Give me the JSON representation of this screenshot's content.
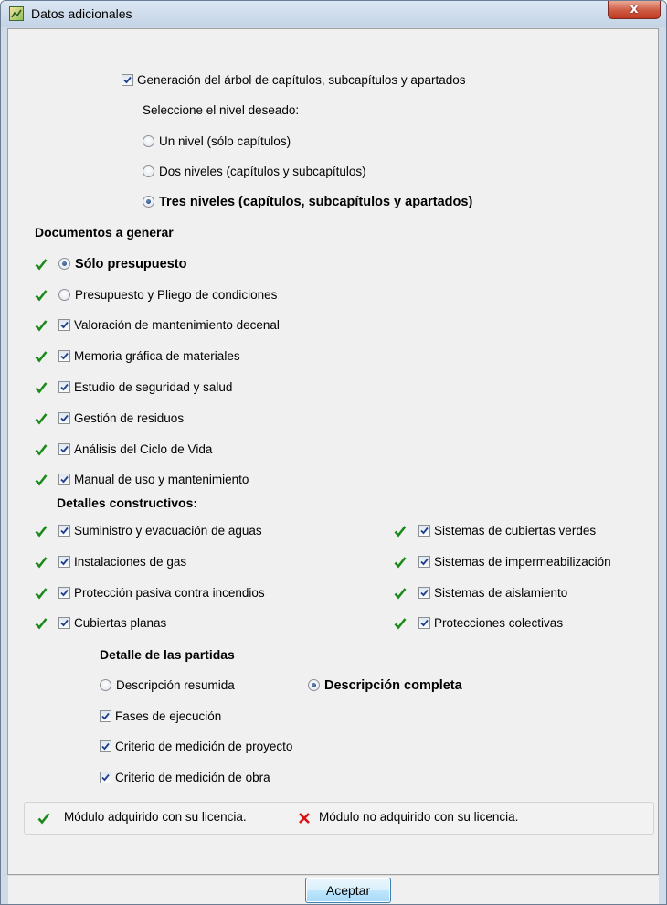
{
  "window": {
    "title": "Datos adicionales",
    "close_label": "x"
  },
  "tree": {
    "generate_label": "Generación del árbol de capítulos, subcapítulos y apartados",
    "generate_checked": true,
    "prompt": "Seleccione el nivel deseado:",
    "levels": [
      {
        "label": "Un nivel (sólo capítulos)",
        "selected": false
      },
      {
        "label": "Dos niveles (capítulos y subcapítulos)",
        "selected": false
      },
      {
        "label": "Tres niveles (capítulos, subcapítulos y apartados)",
        "selected": true
      }
    ]
  },
  "documents": {
    "heading": "Documentos a generar",
    "radio_options": [
      {
        "label": "Sólo presupuesto",
        "selected": true
      },
      {
        "label": "Presupuesto y Pliego de condiciones",
        "selected": false
      }
    ],
    "checkbox_items": [
      {
        "label": "Valoración de mantenimiento decenal",
        "checked": true
      },
      {
        "label": "Memoria gráfica de materiales",
        "checked": true
      },
      {
        "label": "Estudio de seguridad y salud",
        "checked": true
      },
      {
        "label": "Gestión de residuos",
        "checked": true
      },
      {
        "label": "Análisis del Ciclo de Vida",
        "checked": true
      },
      {
        "label": "Manual de uso y mantenimiento",
        "checked": true
      }
    ]
  },
  "details": {
    "heading": "Detalles constructivos:",
    "left": [
      {
        "label": "Suministro y evacuación de aguas",
        "checked": true
      },
      {
        "label": "Instalaciones de gas",
        "checked": true
      },
      {
        "label": "Protección pasiva contra incendios",
        "checked": true
      },
      {
        "label": "Cubiertas planas",
        "checked": true
      }
    ],
    "right": [
      {
        "label": "Sistemas de cubiertas verdes",
        "checked": true
      },
      {
        "label": "Sistemas de impermeabilización",
        "checked": true
      },
      {
        "label": "Sistemas de aislamiento",
        "checked": true
      },
      {
        "label": "Protecciones colectivas",
        "checked": true
      }
    ]
  },
  "partidas": {
    "heading": "Detalle de las partidas",
    "desc_summary": "Descripción resumida",
    "desc_full": "Descripción completa",
    "selected": "Descripción completa",
    "options": [
      {
        "label": "Fases de ejecución",
        "checked": true
      },
      {
        "label": "Criterio de medición de proyecto",
        "checked": true
      },
      {
        "label": "Criterio de medición de obra",
        "checked": true
      }
    ]
  },
  "legend": {
    "acquired": "Módulo adquirido con su licencia.",
    "not_acquired": "Módulo no adquirido con su licencia.",
    "acquired_color": "#1a8a1a",
    "not_acquired_color": "#e01010"
  },
  "footer": {
    "ok_label": "Aceptar"
  }
}
